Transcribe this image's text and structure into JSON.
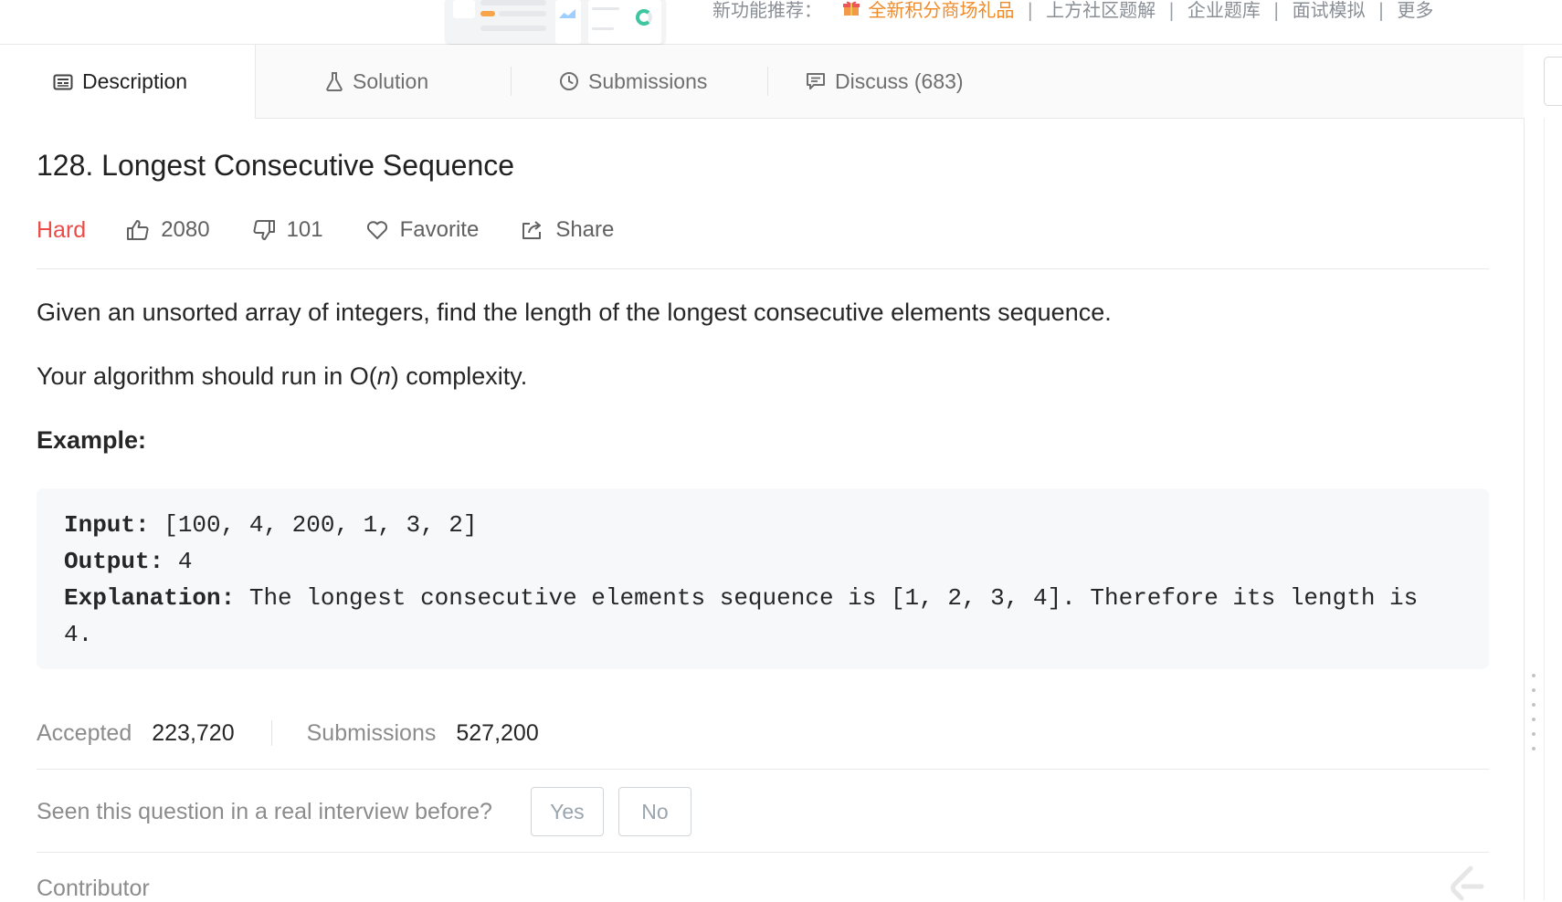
{
  "promo": {
    "prefix": "新功能推荐：",
    "highlight": "全新积分商场礼品",
    "links": [
      "上方社区题解",
      "企业题库",
      "面试模拟",
      "更多"
    ]
  },
  "tabs": [
    {
      "label": "Description",
      "icon": "description-icon",
      "active": true
    },
    {
      "label": "Solution",
      "icon": "flask-icon",
      "active": false
    },
    {
      "label": "Submissions",
      "icon": "clock-icon",
      "active": false
    },
    {
      "label": "Discuss (683)",
      "icon": "comment-icon",
      "active": false
    }
  ],
  "problem": {
    "title": "128. Longest Consecutive Sequence",
    "difficulty": "Hard",
    "likes": "2080",
    "dislikes": "101",
    "favorite_label": "Favorite",
    "share_label": "Share",
    "paragraph1": "Given an unsorted array of integers, find the length of the longest consecutive elements sequence.",
    "paragraph2_prefix": "Your algorithm should run in O(",
    "paragraph2_var": "n",
    "paragraph2_suffix": ") complexity.",
    "example_heading": "Example:",
    "example": {
      "input_label": "Input:",
      "input_value": " [100, 4, 200, 1, 3, 2]",
      "output_label": "Output:",
      "output_value": " 4",
      "explanation_label": "Explanation:",
      "explanation_value": " The longest consecutive elements sequence is [1, 2, 3, 4]. Therefore its length is",
      "explanation_cont": "4."
    }
  },
  "stats": {
    "accepted_label": "Accepted",
    "accepted_value": "223,720",
    "submissions_label": "Submissions",
    "submissions_value": "527,200"
  },
  "interview": {
    "question": "Seen this question in a real interview before?",
    "yes_label": "Yes",
    "no_label": "No"
  },
  "contributor_label": "Contributor",
  "colors": {
    "difficulty_hard": "#ec4c47",
    "promo_highlight": "#ef8b2a",
    "code_bg": "#f7f8fa"
  }
}
